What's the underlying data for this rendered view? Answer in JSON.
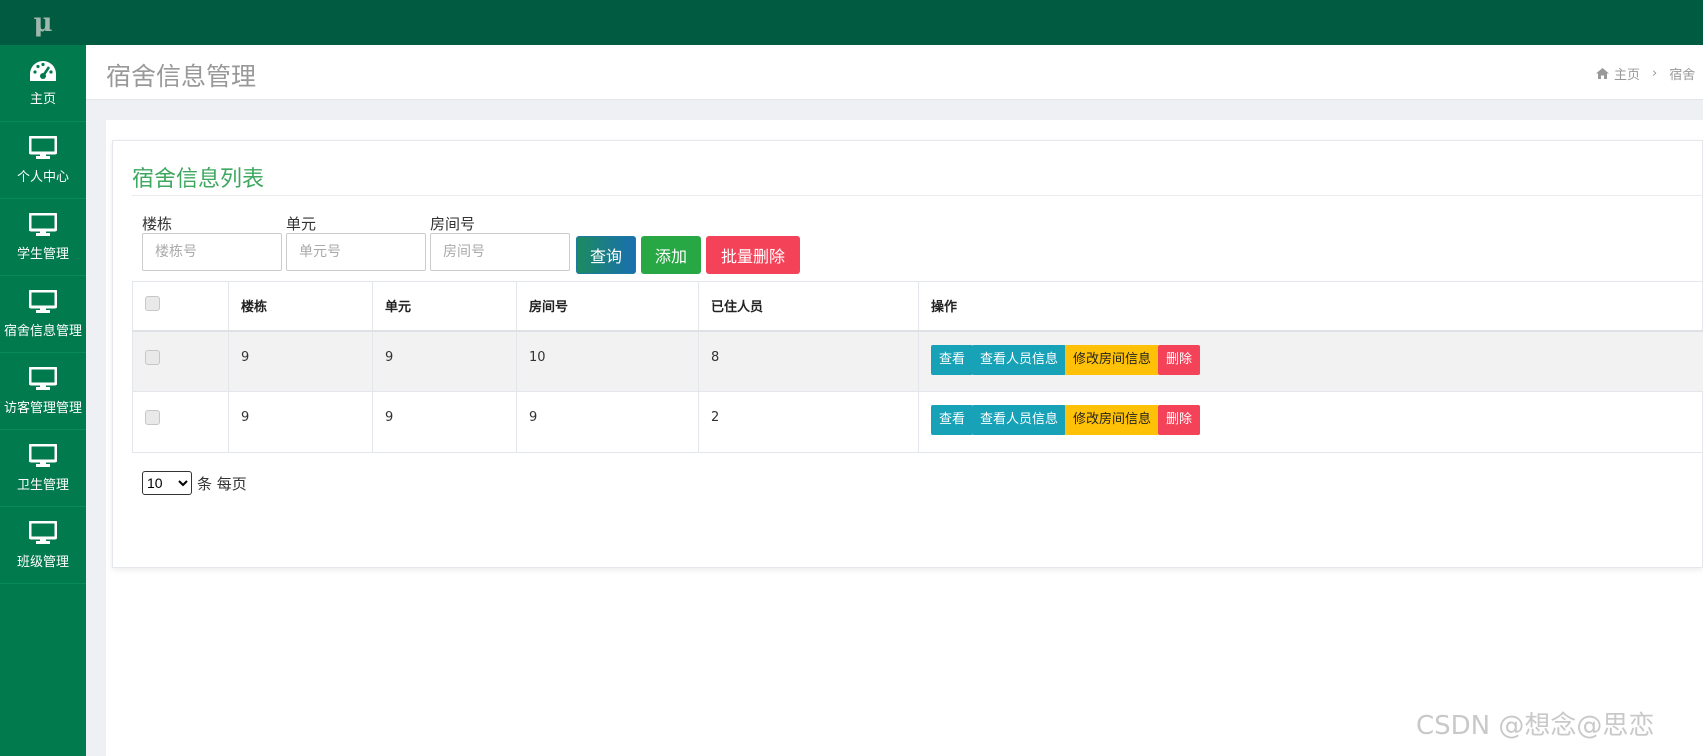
{
  "logo": "μ",
  "sidebar": {
    "items": [
      {
        "label": "主页",
        "icon": "dashboard-icon"
      },
      {
        "label": "个人中心",
        "icon": "monitor-icon"
      },
      {
        "label": "学生管理",
        "icon": "monitor-icon"
      },
      {
        "label": "宿舍信息管理",
        "icon": "monitor-icon"
      },
      {
        "label": "访客管理管理",
        "icon": "monitor-icon"
      },
      {
        "label": "卫生管理",
        "icon": "monitor-icon"
      },
      {
        "label": "班级管理",
        "icon": "monitor-icon"
      }
    ]
  },
  "header": {
    "page_title": "宿舍信息管理",
    "breadcrumb": {
      "home": "主页",
      "current": "宿舍"
    }
  },
  "card": {
    "title": "宿舍信息列表"
  },
  "search": {
    "building": {
      "label": "楼栋",
      "placeholder": "楼栋号"
    },
    "unit": {
      "label": "单元",
      "placeholder": "单元号"
    },
    "room": {
      "label": "房间号",
      "placeholder": "房间号"
    },
    "query_label": "查询",
    "add_label": "添加",
    "batch_delete_label": "批量删除"
  },
  "table": {
    "headers": [
      "楼栋",
      "单元",
      "房间号",
      "已住人员",
      "操作"
    ],
    "rows": [
      {
        "building": "9",
        "unit": "9",
        "room": "10",
        "occupants": "8"
      },
      {
        "building": "9",
        "unit": "9",
        "room": "9",
        "occupants": "2"
      }
    ],
    "actions": {
      "view": "查看",
      "view_people": "查看人员信息",
      "edit_room": "修改房间信息",
      "delete": "删除"
    }
  },
  "pager": {
    "page_size": "10",
    "suffix": "条 每页"
  },
  "watermark": "CSDN @想念@思恋",
  "colors": {
    "sidebar": "#017a4d",
    "topbar": "#015b40",
    "title": "#3ea861",
    "info": "#17a2b8",
    "warning": "#ffc107",
    "danger": "#f44258",
    "success": "#28a745"
  }
}
